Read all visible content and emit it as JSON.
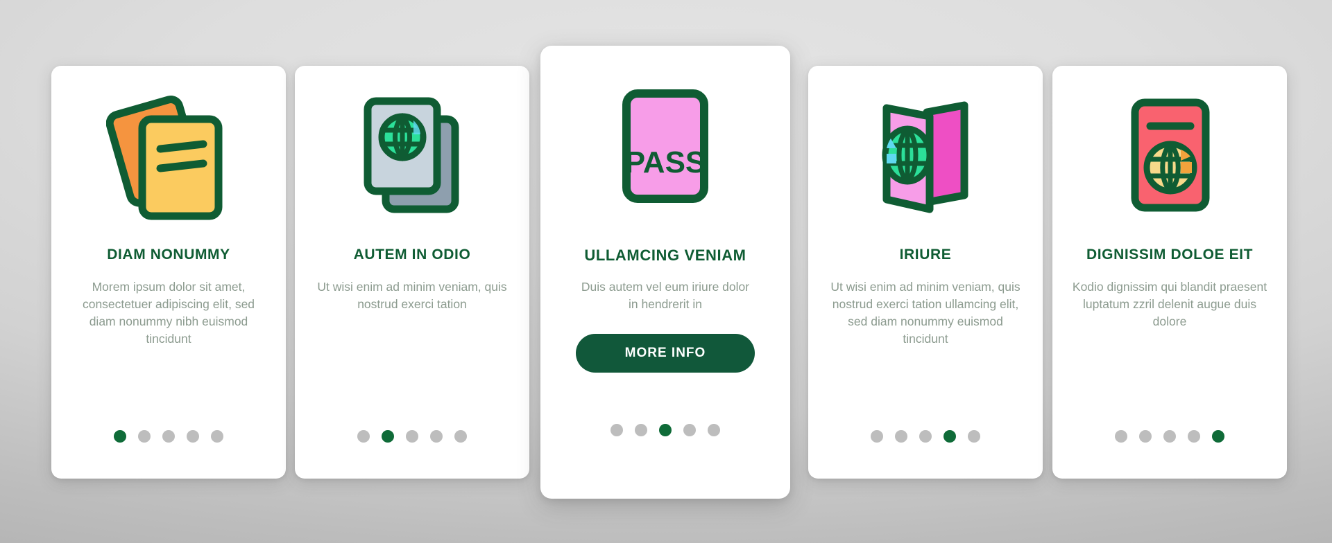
{
  "theme": {
    "accent_green": "#0f5c33",
    "button_green": "#11583a",
    "dot_active": "#0f6b38",
    "dot_inactive": "#bdbdbd",
    "body_text": "#8c9b8f",
    "card_bg": "#ffffff",
    "page_bg": "#d4d4d4"
  },
  "cards": [
    {
      "icon_name": "documents-stack-icon",
      "title": "DIAM NONUMMY",
      "body": "Morem ipsum dolor sit amet, consectetuer adipiscing elit, sed diam nonummy nibh euismod tincidunt",
      "dots_total": 5,
      "dots_active_index": 0,
      "icon_colors": {
        "front": "#fbcb5f",
        "back": "#f5943f",
        "stroke": "#0f5c33"
      }
    },
    {
      "icon_name": "passport-books-stack-icon",
      "title": "AUTEM IN ODIO",
      "body": "Ut wisi enim ad minim veniam, quis nostrud exerci tation",
      "dots_total": 5,
      "dots_active_index": 1,
      "icon_colors": {
        "front": "#c8d4dd",
        "back": "#8e9fae",
        "globe_a": "#2ce09a",
        "globe_b": "#5fd9f0",
        "stroke": "#0f5c33"
      }
    },
    {
      "icon_name": "pass-card-icon",
      "icon_label": "PASS",
      "title": "ULLAMCING VENIAM",
      "body": "Duis autem vel eum iriure dolor in hendrerit in",
      "button_label": "MORE INFO",
      "dots_total": 5,
      "dots_active_index": 2,
      "icon_colors": {
        "fill": "#f79de8",
        "stroke": "#0f5c33"
      }
    },
    {
      "icon_name": "open-passport-icon",
      "title": "IRIURE",
      "body": "Ut wisi enim ad minim veniam, quis nostrud exerci tation ullamcing elit, sed diam nonummy euismod tincidunt",
      "dots_total": 5,
      "dots_active_index": 3,
      "icon_colors": {
        "front": "#f79de8",
        "back": "#ee4fc4",
        "globe_a": "#2ce09a",
        "globe_b": "#5fd9f0",
        "stroke": "#0f5c33"
      }
    },
    {
      "icon_name": "passport-cover-icon",
      "title": "DIGNISSIM DOLOE EIT",
      "body": "Kodio dignissim qui blandit praesent luptatum zzril delenit augue duis dolore",
      "dots_total": 5,
      "dots_active_index": 4,
      "icon_colors": {
        "fill": "#f9626f",
        "globe_a": "#f7d98a",
        "globe_b": "#f2a33c",
        "stroke": "#0f5c33"
      }
    }
  ]
}
